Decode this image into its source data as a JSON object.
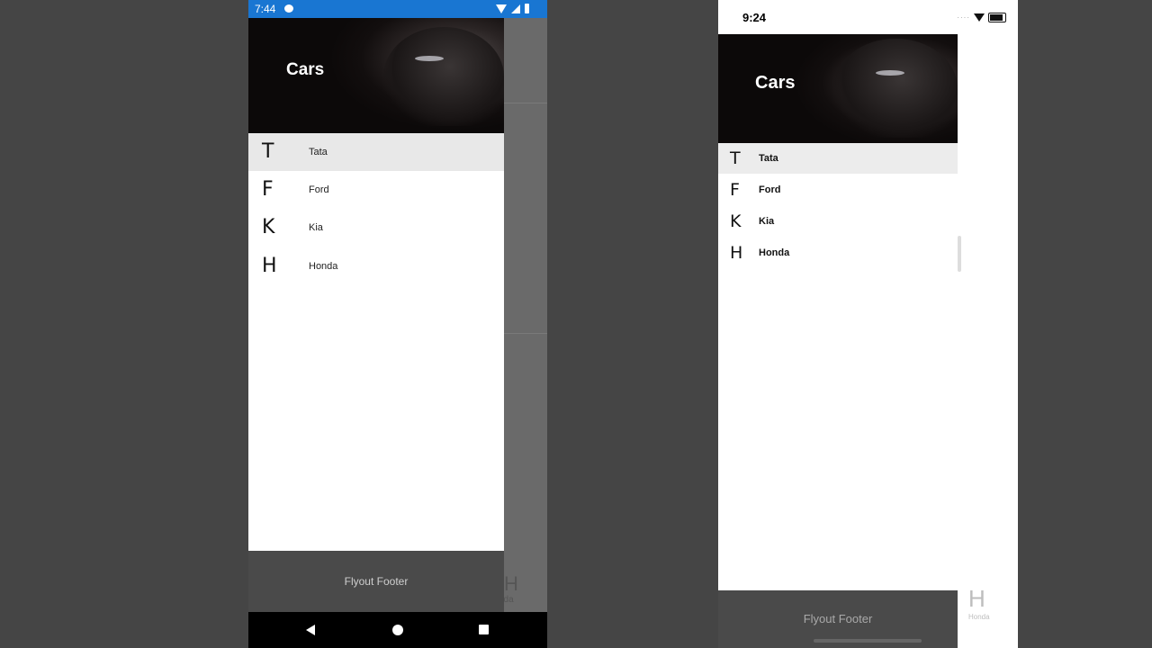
{
  "android": {
    "status": {
      "time": "7:44"
    },
    "header": {
      "title": "Cars"
    },
    "items": [
      {
        "letter": "T",
        "label": "Tata"
      },
      {
        "letter": "F",
        "label": "Ford"
      },
      {
        "letter": "K",
        "label": "Kia"
      },
      {
        "letter": "H",
        "label": "Honda"
      }
    ],
    "footer": "Flyout Footer",
    "behind": {
      "letter": "H",
      "label": "nda"
    }
  },
  "ios": {
    "status": {
      "time": "9:24"
    },
    "header": {
      "title": "Cars"
    },
    "items": [
      {
        "letter": "T",
        "label": "Tata"
      },
      {
        "letter": "F",
        "label": "Ford"
      },
      {
        "letter": "K",
        "label": "Kia"
      },
      {
        "letter": "H",
        "label": "Honda"
      }
    ],
    "footer": "Flyout Footer",
    "behind": {
      "letter": "H",
      "label": "Honda"
    }
  },
  "colors": {
    "android_status_bar": "#1976d2",
    "selected_row": "#e8e8e8",
    "footer_bg": "#4a4a4a",
    "backdrop": "#454545"
  }
}
